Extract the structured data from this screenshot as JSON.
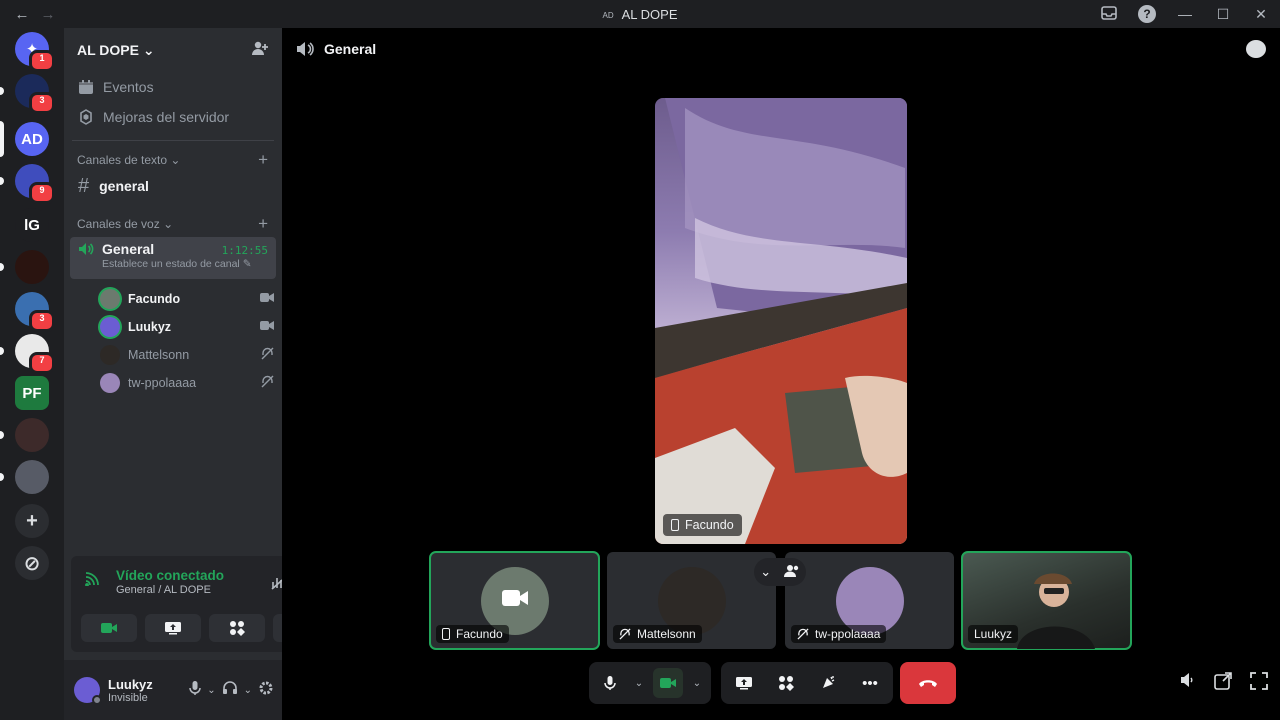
{
  "titlebar": {
    "back": "←",
    "forward": "→",
    "server_abbrev": "AD",
    "window_title": "AL DOPE",
    "inbox_icon": "inbox-icon",
    "help_icon": "help-icon",
    "help_glyph": "?",
    "minimize": "—",
    "maximize": "☐",
    "close": "✕"
  },
  "guilds": [
    {
      "name": "discord-home",
      "badge": "1",
      "color": "#5865f2",
      "text": "✦"
    },
    {
      "name": "server-2",
      "badge": "3",
      "color": "#1b2a5a",
      "text": ""
    },
    {
      "name": "server-al-dope",
      "badge": "",
      "color": "#5865f2",
      "text": "AD"
    },
    {
      "name": "server-4",
      "badge": "9",
      "color": "#3f4dbd",
      "text": ""
    },
    {
      "name": "server-lg",
      "badge": "",
      "color": "#1e1f22",
      "text": "lG"
    },
    {
      "name": "server-6",
      "badge": "",
      "color": "#2a1410",
      "text": ""
    },
    {
      "name": "server-7",
      "badge": "3",
      "color": "#3a6fb0",
      "text": ""
    },
    {
      "name": "server-8",
      "badge": "7",
      "color": "#e9e9e9",
      "text": ""
    },
    {
      "name": "server-pf",
      "badge": "",
      "color": "#1e7a3e",
      "text": "PF"
    },
    {
      "name": "server-10",
      "badge": "",
      "color": "#3d2a2a",
      "text": ""
    },
    {
      "name": "server-11",
      "badge": "",
      "color": "#575b66",
      "text": ""
    }
  ],
  "sidebar": {
    "server_name": "AL DOPE",
    "menu": [
      {
        "label": "Eventos",
        "icon": "calendar-icon"
      },
      {
        "label": "Mejoras del servidor",
        "icon": "boost-icon"
      }
    ],
    "text_category": "Canales de texto",
    "text_channels": [
      {
        "label": "general"
      }
    ],
    "voice_category": "Canales de voz",
    "voice_channel": {
      "label": "General",
      "timer": "1:12:55",
      "status": "Establece un estado de canal"
    },
    "members": [
      {
        "name": "Facundo",
        "bold": true,
        "icon": "video-icon",
        "color": "#6c7a6e"
      },
      {
        "name": "Luukyz",
        "bold": true,
        "icon": "video-icon",
        "color": "#6b5dd3"
      },
      {
        "name": "Mattelsonn",
        "bold": false,
        "icon": "deafened-icon",
        "color": "#2d2926"
      },
      {
        "name": "tw-ppolaaaa",
        "bold": false,
        "icon": "deafened-icon",
        "color": "#9a86b8"
      }
    ]
  },
  "rtc": {
    "status": "Vídeo conectado",
    "location": "General / AL DOPE"
  },
  "user": {
    "name": "Luukyz",
    "status": "Invisible"
  },
  "stage": {
    "channel": "General",
    "focus_label": "Facundo",
    "tiles": [
      {
        "name": "Facundo",
        "speaking": true,
        "icon": "phone-icon",
        "color": "#6c7a6e"
      },
      {
        "name": "Mattelsonn",
        "speaking": false,
        "icon": "deafened-icon",
        "color": "#2d2926"
      },
      {
        "name": "tw-ppolaaaa",
        "speaking": false,
        "icon": "deafened-icon",
        "color": "#9a86b8"
      },
      {
        "name": "Luukyz",
        "speaking": true,
        "icon": "",
        "color": "#3b4a43"
      }
    ]
  },
  "colors": {
    "accent_green": "#23a55a",
    "danger_red": "#da373c",
    "sidebar_bg": "#2b2d31"
  }
}
